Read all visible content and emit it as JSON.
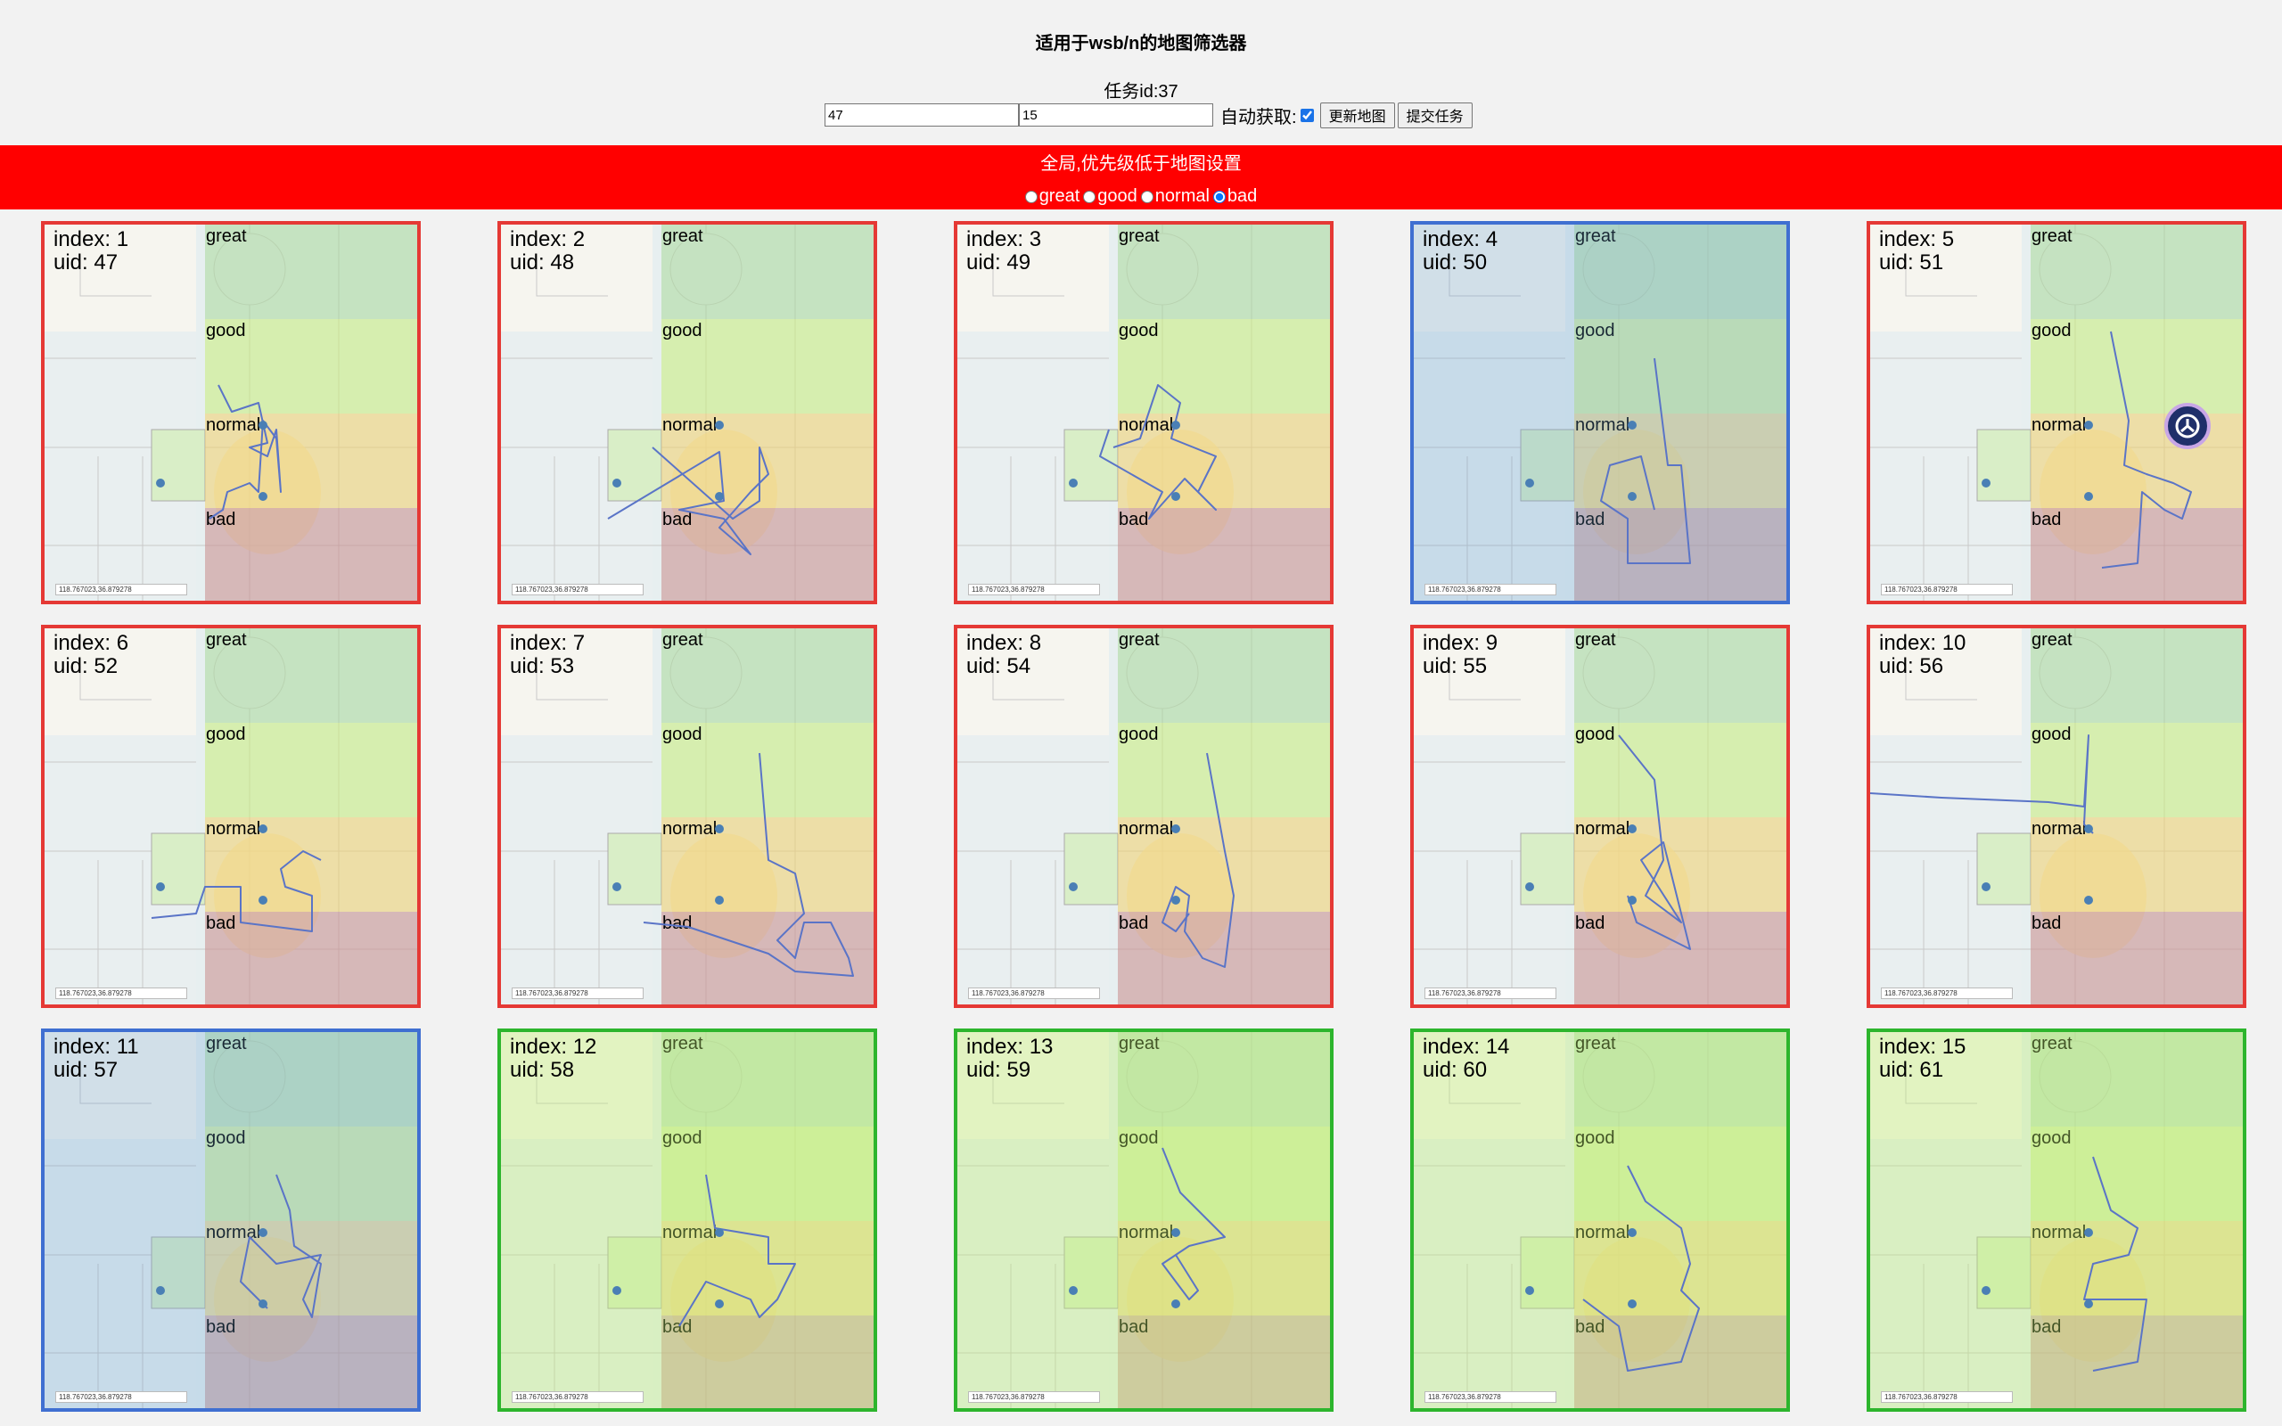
{
  "header": {
    "title": "适用于wsb/n的地图筛选器",
    "task_id": "任务id:37",
    "input1_value": "47",
    "input2_value": "15",
    "auto_label": "自动获取:",
    "auto_checked": true,
    "update_button": "更新地图",
    "submit_button": "提交任务"
  },
  "global_bar": {
    "title": "全局,优先级低于地图设置",
    "options": [
      "great",
      "good",
      "normal",
      "bad"
    ],
    "selected": "bad",
    "color": "#ff0000"
  },
  "zones": {
    "labels": [
      "great",
      "good",
      "normal",
      "bad"
    ],
    "colors": {
      "great": "#a9d89a",
      "good": "#c9ec7a",
      "normal": "#f3cf6b",
      "bad": "#c98a8a"
    }
  },
  "coord_text": "118.767023,36.879278",
  "status_colors": {
    "bad": "#e53935",
    "normal": "#3f6fd1",
    "good": "#2db52d"
  },
  "cards": [
    {
      "index_text": "index: 1",
      "uid_text": "uid: 47",
      "status": "bad"
    },
    {
      "index_text": "index: 2",
      "uid_text": "uid: 48",
      "status": "bad"
    },
    {
      "index_text": "index: 3",
      "uid_text": "uid: 49",
      "status": "bad"
    },
    {
      "index_text": "index: 4",
      "uid_text": "uid: 50",
      "status": "normal"
    },
    {
      "index_text": "index: 5",
      "uid_text": "uid: 51",
      "status": "bad"
    },
    {
      "index_text": "index: 6",
      "uid_text": "uid: 52",
      "status": "bad"
    },
    {
      "index_text": "index: 7",
      "uid_text": "uid: 53",
      "status": "bad"
    },
    {
      "index_text": "index: 8",
      "uid_text": "uid: 54",
      "status": "bad"
    },
    {
      "index_text": "index: 9",
      "uid_text": "uid: 55",
      "status": "bad"
    },
    {
      "index_text": "index: 10",
      "uid_text": "uid: 56",
      "status": "bad"
    },
    {
      "index_text": "index: 11",
      "uid_text": "uid: 57",
      "status": "normal"
    },
    {
      "index_text": "index: 12",
      "uid_text": "uid: 58",
      "status": "good"
    },
    {
      "index_text": "index: 13",
      "uid_text": "uid: 59",
      "status": "good"
    },
    {
      "index_text": "index: 14",
      "uid_text": "uid: 60",
      "status": "good"
    },
    {
      "index_text": "index: 15",
      "uid_text": "uid: 61",
      "status": "good"
    }
  ]
}
